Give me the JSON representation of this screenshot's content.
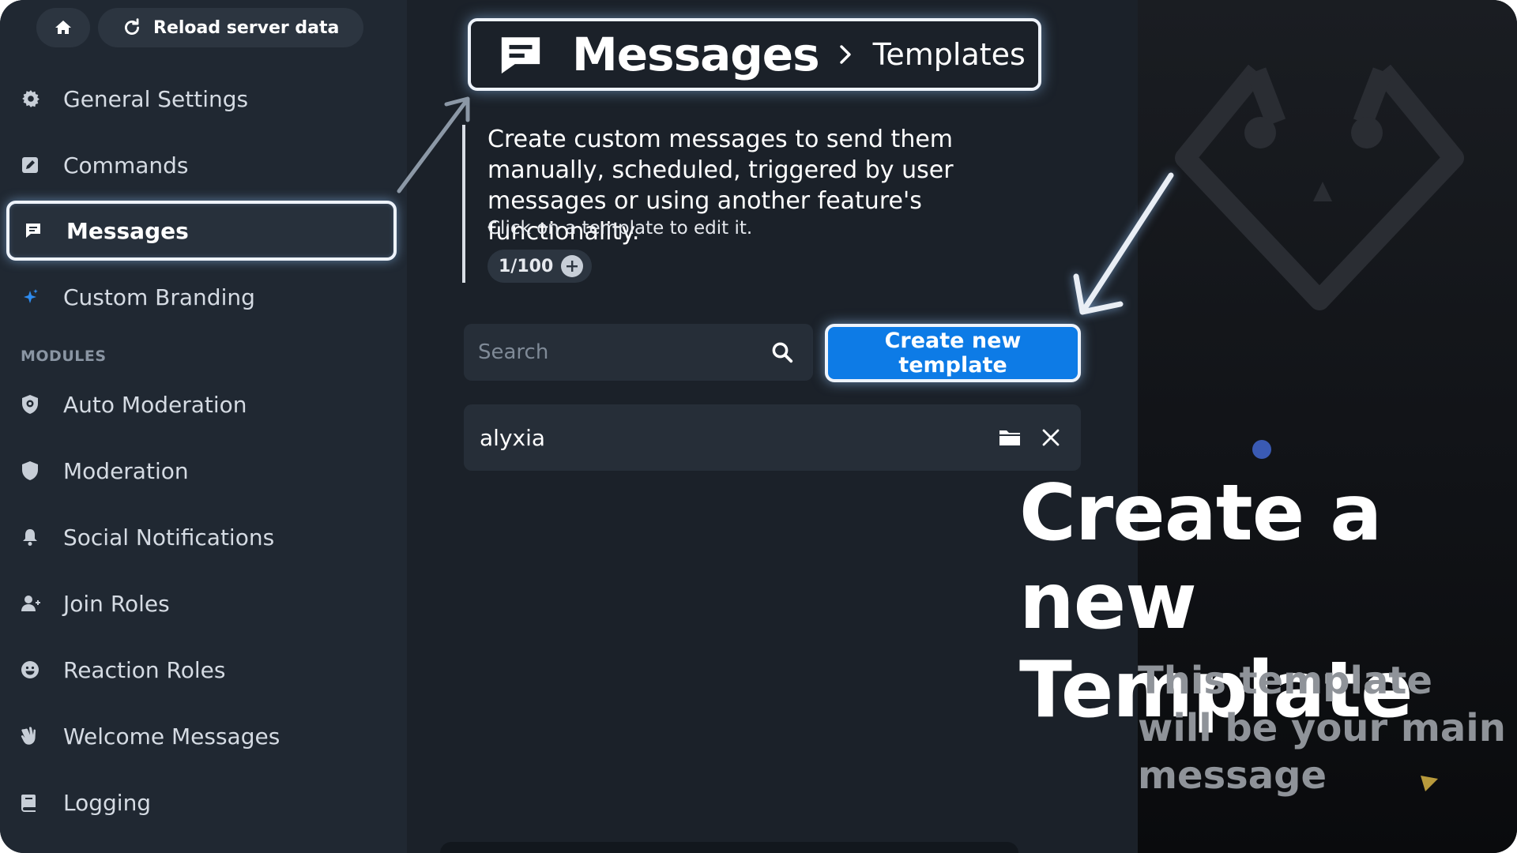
{
  "topbar": {
    "home_icon": "home-icon",
    "reload_label": "Reload server data",
    "reload_icon": "refresh-icon"
  },
  "sidebar": {
    "items": [
      {
        "label": "General Settings",
        "icon": "gear-icon"
      },
      {
        "label": "Commands",
        "icon": "edit-square-icon"
      },
      {
        "label": "Messages",
        "icon": "message-icon",
        "active": true
      },
      {
        "label": "Custom Branding",
        "icon": "sparkle-icon"
      }
    ],
    "section_label": "MODULES",
    "modules": [
      {
        "label": "Auto Moderation",
        "icon": "shield-gear-icon"
      },
      {
        "label": "Moderation",
        "icon": "shield-icon"
      },
      {
        "label": "Social Notifications",
        "icon": "bell-icon"
      },
      {
        "label": "Join Roles",
        "icon": "user-plus-icon"
      },
      {
        "label": "Reaction Roles",
        "icon": "smiley-icon"
      },
      {
        "label": "Welcome Messages",
        "icon": "wave-hand-icon"
      },
      {
        "label": "Logging",
        "icon": "book-icon"
      }
    ]
  },
  "breadcrumb": {
    "title": "Messages",
    "separator_icon": "chevron-right-icon",
    "current": "Templates"
  },
  "description": {
    "main": "Create custom messages to send them manually, scheduled, triggered by user messages or using another feature's functionality.",
    "hint": "Click on a template to edit it."
  },
  "counter": {
    "value": "1/100"
  },
  "search": {
    "placeholder": "Search",
    "value": ""
  },
  "create_button": {
    "label": "Create new template"
  },
  "templates": [
    {
      "name": "alyxia"
    }
  ],
  "overlay": {
    "headline": "Create a new Template",
    "subline": "This template will be your main message"
  },
  "colors": {
    "accent": "#0d7be6",
    "sidebar_bg": "#202832",
    "main_bg": "#1b2129",
    "highlight_border": "#eef3fb"
  }
}
